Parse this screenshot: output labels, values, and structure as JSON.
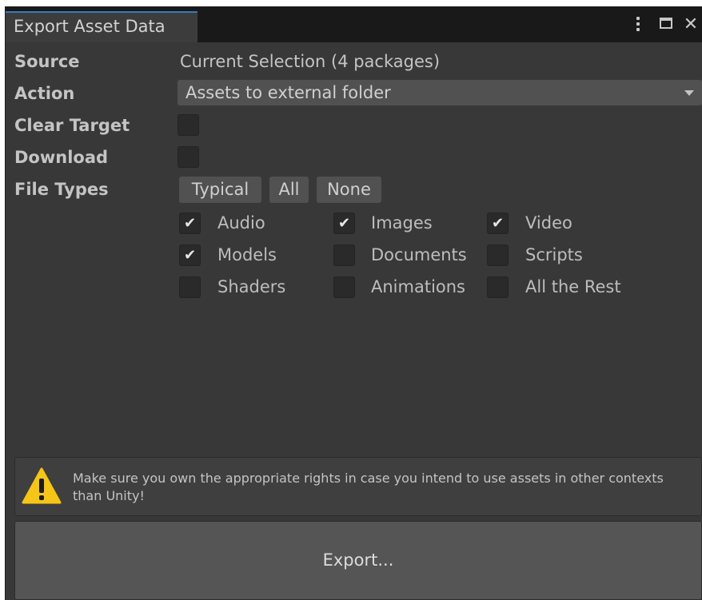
{
  "window": {
    "tab_title": "Export Asset Data",
    "close_glyph": "✕"
  },
  "form": {
    "source": {
      "label": "Source",
      "value": "Current Selection (4 packages)"
    },
    "action": {
      "label": "Action",
      "selected": "Assets to external folder"
    },
    "clear_target": {
      "label": "Clear Target",
      "checked": false
    },
    "download": {
      "label": "Download",
      "checked": false
    },
    "file_types": {
      "label": "File Types",
      "presets": [
        "Typical",
        "All",
        "None"
      ],
      "options": [
        {
          "label": "Audio",
          "checked": true
        },
        {
          "label": "Images",
          "checked": true
        },
        {
          "label": "Video",
          "checked": true
        },
        {
          "label": "Models",
          "checked": true
        },
        {
          "label": "Documents",
          "checked": false
        },
        {
          "label": "Scripts",
          "checked": false
        },
        {
          "label": "Shaders",
          "checked": false
        },
        {
          "label": "Animations",
          "checked": false
        },
        {
          "label": "All the Rest",
          "checked": false
        }
      ]
    }
  },
  "help": {
    "icon": "warning-triangle-icon",
    "text": "Make sure you own the appropriate rights in case you intend to use assets in other contexts than Unity!"
  },
  "export_button": {
    "label": "Export..."
  },
  "colors": {
    "panel": "#383838",
    "tab_accent": "#3a79bb",
    "warning": "#f5c518"
  }
}
